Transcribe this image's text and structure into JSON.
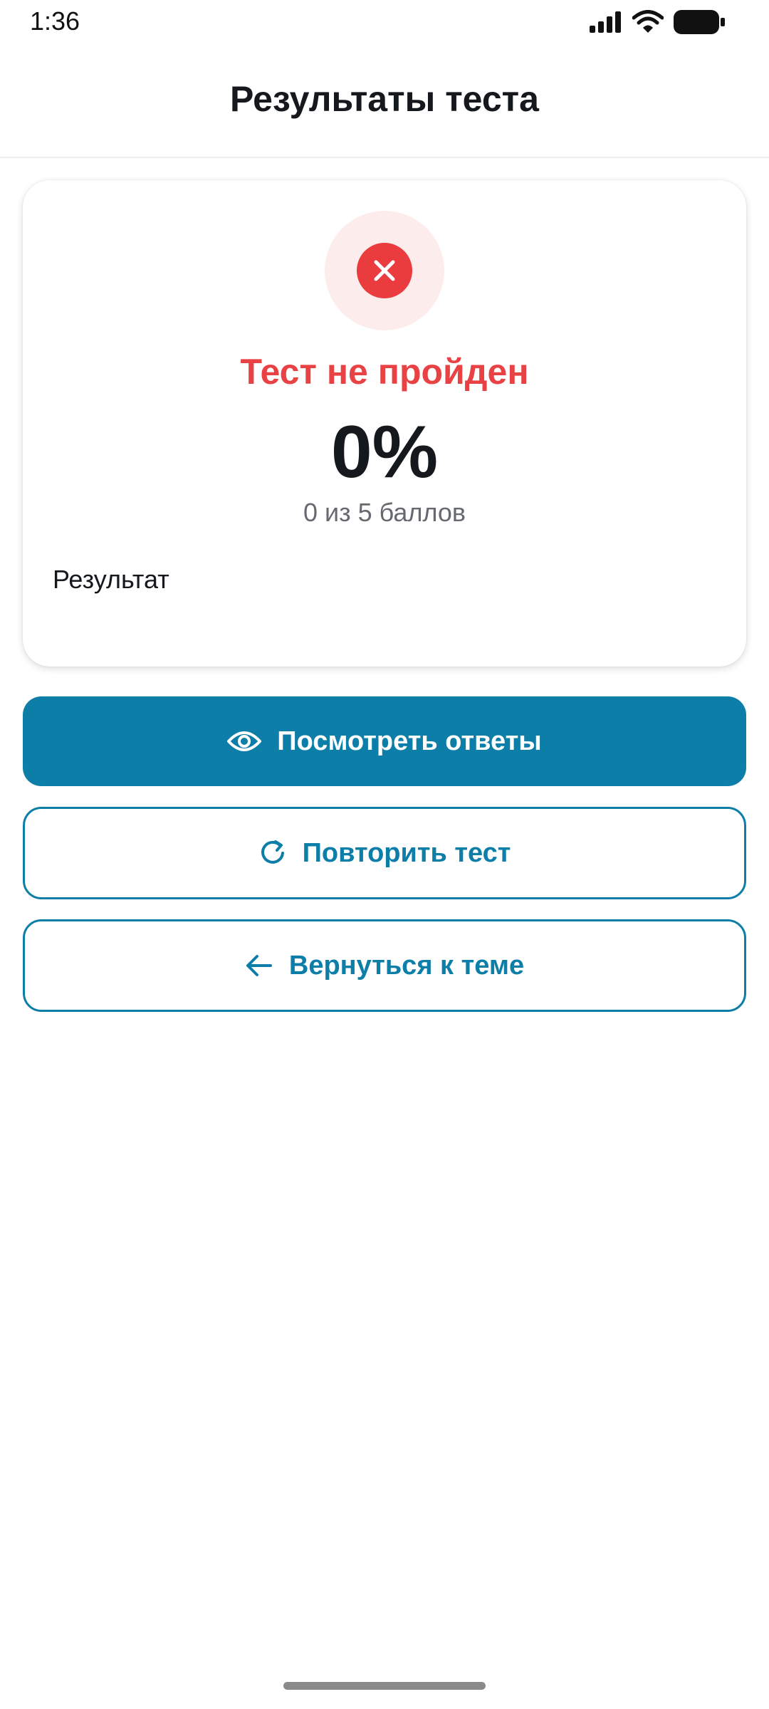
{
  "status_bar": {
    "time": "1:36",
    "icons": [
      "signal-icon",
      "wifi-icon",
      "battery-icon"
    ]
  },
  "header": {
    "title": "Результаты теста"
  },
  "result": {
    "icon": "close-icon",
    "status": "Тест не пройден",
    "percent": "0%",
    "points": "0 из 5 баллов",
    "label": "Результат"
  },
  "actions": {
    "view_answers": {
      "label": "Посмотреть ответы",
      "icon": "eye-icon"
    },
    "retry": {
      "label": "Повторить тест",
      "icon": "refresh-icon"
    },
    "back": {
      "label": "Вернуться к теме",
      "icon": "arrow-left-icon"
    }
  },
  "colors": {
    "primary": "#0c7ea8",
    "fail": "#ea3c3f",
    "fail_bg": "#fdecec",
    "text": "#15181c",
    "muted": "#666a70"
  }
}
